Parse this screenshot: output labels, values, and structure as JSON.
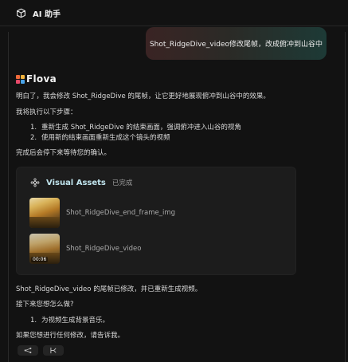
{
  "header": {
    "title": "AI 助手",
    "icon": "cube-icon"
  },
  "user_message": "Shot_RidgeDive_video修改尾帧，改成俯冲到山谷中",
  "assistant": {
    "brand": "Flova",
    "intro": "明白了，我会修改 Shot_RidgeDive 的尾帧，让它更好地展现俯冲到山谷中的效果。",
    "steps_title": "我将执行以下步骤：",
    "steps": [
      {
        "num": "1.",
        "text": "重新生成 Shot_RidgeDive 的结束画面，强调俯冲进入山谷的视角"
      },
      {
        "num": "2.",
        "text": "使用新的结束画面重新生成这个镜头的视频"
      }
    ],
    "wait": "完成后会停下来等待您的确认。"
  },
  "card": {
    "title": "Visual Assets",
    "status": "已完成",
    "assets": [
      {
        "name": "Shot_RidgeDive_end_frame_img",
        "duration": ""
      },
      {
        "name": "Shot_RidgeDive_video",
        "duration": "00:06"
      }
    ]
  },
  "followup": {
    "result": "Shot_RidgeDive_video 的尾帧已修改，并已重新生成视频。",
    "next_q": "接下来您想怎么做?",
    "options": [
      {
        "num": "1.",
        "text": "为视频生成背景音乐。"
      }
    ],
    "closing": "如果您想进行任何修改，请告诉我。"
  },
  "actions": [
    {
      "icon": "share-icon"
    },
    {
      "icon": "branch-icon"
    }
  ]
}
